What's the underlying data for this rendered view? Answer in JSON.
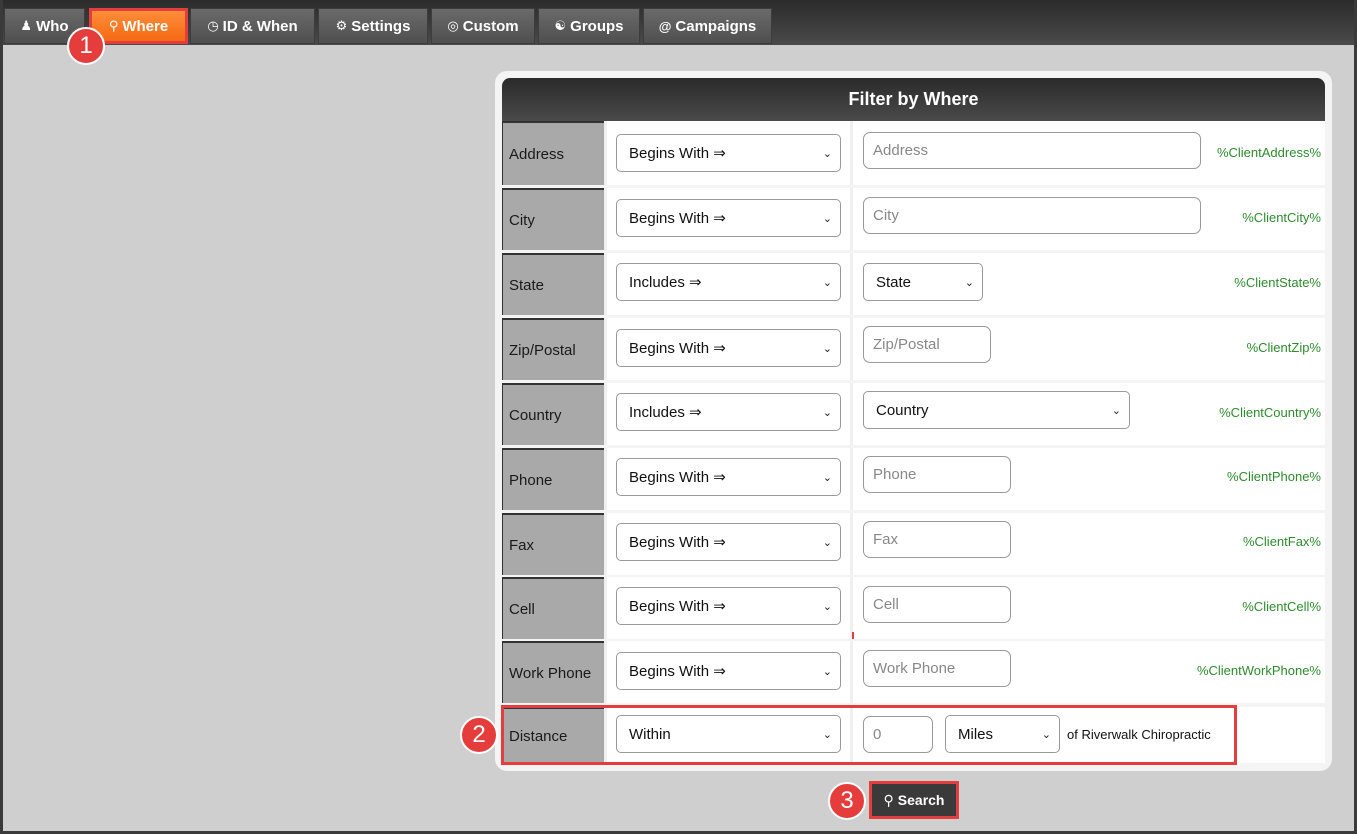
{
  "nav": {
    "tabs": [
      {
        "label": "Who",
        "icon": "user-icon"
      },
      {
        "label": "Where",
        "icon": "map-pin-icon",
        "active": true
      },
      {
        "label": "ID & When",
        "icon": "clock-icon"
      },
      {
        "label": "Settings",
        "icon": "gear-icon"
      },
      {
        "label": "Custom",
        "icon": "target-icon"
      },
      {
        "label": "Groups",
        "icon": "group-icon"
      },
      {
        "label": "Campaigns",
        "icon": "at-icon"
      }
    ]
  },
  "callouts": [
    "1",
    "2",
    "3"
  ],
  "panel": {
    "title": "Filter by Where",
    "rows": [
      {
        "label": "Address",
        "operator": "Begins With ⇒",
        "placeholder": "Address",
        "token": "%ClientAddress%"
      },
      {
        "label": "City",
        "operator": "Begins With ⇒",
        "placeholder": "City",
        "token": "%ClientCity%"
      },
      {
        "label": "State",
        "operator": "Includes ⇒",
        "select_value": "State",
        "token": "%ClientState%"
      },
      {
        "label": "Zip/Postal",
        "operator": "Begins With ⇒",
        "placeholder": "Zip/Postal",
        "token": "%ClientZip%"
      },
      {
        "label": "Country",
        "operator": "Includes ⇒",
        "select_value": "Country",
        "token": "%ClientCountry%"
      },
      {
        "label": "Phone",
        "operator": "Begins With ⇒",
        "placeholder": "Phone",
        "token": "%ClientPhone%"
      },
      {
        "label": "Fax",
        "operator": "Begins With ⇒",
        "placeholder": "Fax",
        "token": "%ClientFax%"
      },
      {
        "label": "Cell",
        "operator": "Begins With ⇒",
        "placeholder": "Cell",
        "token": "%ClientCell%"
      },
      {
        "label": "Work Phone",
        "operator": "Begins With ⇒",
        "placeholder": "Work Phone",
        "token": "%ClientWorkPhone%"
      }
    ],
    "distance": {
      "label": "Distance",
      "operator": "Within",
      "value_placeholder": "0",
      "unit": "Miles",
      "suffix": "of Riverwalk Chiropractic"
    },
    "search_label": "Search"
  },
  "colors": {
    "accent": "#f46a12",
    "highlight": "#e53c3c",
    "token": "#2e8b2e"
  }
}
